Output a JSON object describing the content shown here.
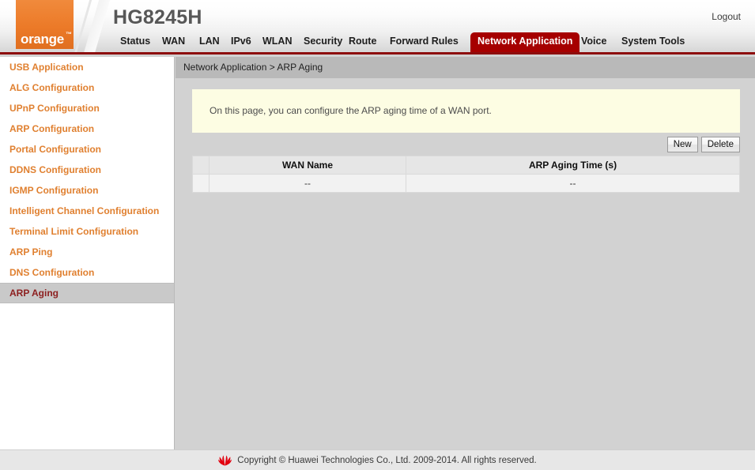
{
  "header": {
    "brand_text": "orange",
    "brand_tm": "™",
    "device_title": "HG8245H",
    "logout_label": "Logout",
    "brand_color": "#ec7a28",
    "accent_color": "#a60000"
  },
  "nav": {
    "items": [
      {
        "label": "Status",
        "active": false
      },
      {
        "label": "WAN",
        "active": false
      },
      {
        "label": "LAN",
        "active": false
      },
      {
        "label": "IPv6",
        "active": false
      },
      {
        "label": "WLAN",
        "active": false
      },
      {
        "label": "Security",
        "active": false
      },
      {
        "label": "Route",
        "active": false
      },
      {
        "label": "Forward Rules",
        "active": false
      },
      {
        "label": "Network Application",
        "active": true
      },
      {
        "label": "Voice",
        "active": false
      },
      {
        "label": "System Tools",
        "active": false
      }
    ]
  },
  "sidebar": {
    "items": [
      {
        "label": "USB Application",
        "selected": false
      },
      {
        "label": "ALG Configuration",
        "selected": false
      },
      {
        "label": "UPnP Configuration",
        "selected": false
      },
      {
        "label": "ARP Configuration",
        "selected": false
      },
      {
        "label": "Portal Configuration",
        "selected": false
      },
      {
        "label": "DDNS Configuration",
        "selected": false
      },
      {
        "label": "IGMP Configuration",
        "selected": false
      },
      {
        "label": "Intelligent Channel Configuration",
        "selected": false
      },
      {
        "label": "Terminal Limit Configuration",
        "selected": false
      },
      {
        "label": "ARP Ping",
        "selected": false
      },
      {
        "label": "DNS Configuration",
        "selected": false
      },
      {
        "label": "ARP Aging",
        "selected": true
      }
    ]
  },
  "main": {
    "breadcrumb": "Network Application > ARP Aging",
    "info_text": "On this page, you can configure the ARP aging time of a WAN port.",
    "buttons": {
      "new_label": "New",
      "delete_label": "Delete"
    },
    "table": {
      "columns": [
        "",
        "WAN Name",
        "ARP Aging Time (s)"
      ],
      "rows": [
        {
          "checkbox": "",
          "wan_name": "--",
          "arp_aging_time": "--"
        }
      ]
    }
  },
  "footer": {
    "copyright": "Copyright © Huawei Technologies Co., Ltd. 2009-2014. All rights reserved.",
    "logo_color": "#e2000f"
  }
}
